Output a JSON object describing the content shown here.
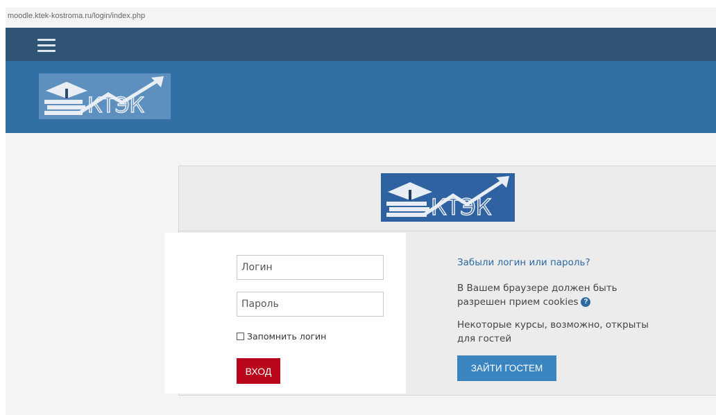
{
  "browser": {
    "url": "moodle.ktek-kostroma.ru/login/index.php"
  },
  "header": {
    "logo_text": "КТЭК"
  },
  "login_form": {
    "username_placeholder": "Логин",
    "password_placeholder": "Пароль",
    "remember_label": "Запомнить логин",
    "remember_checked": false,
    "submit_label": "ВХОД"
  },
  "info": {
    "forgot_link": "Забыли логин или пароль?",
    "cookies_text": "В Вашем браузере должен быть разрешен прием cookies",
    "guests_text": "Некоторые курсы, возможно, открыты для гостей",
    "guest_button_label": "ЗАЙТИ ГОСТЕМ"
  },
  "colors": {
    "navbar": "#2f5373",
    "header": "#3170a5",
    "login_button": "#b8071a",
    "guest_button": "#3a85c0",
    "link": "#2a6aa0"
  },
  "icons": [
    "menu-icon",
    "help-icon"
  ]
}
